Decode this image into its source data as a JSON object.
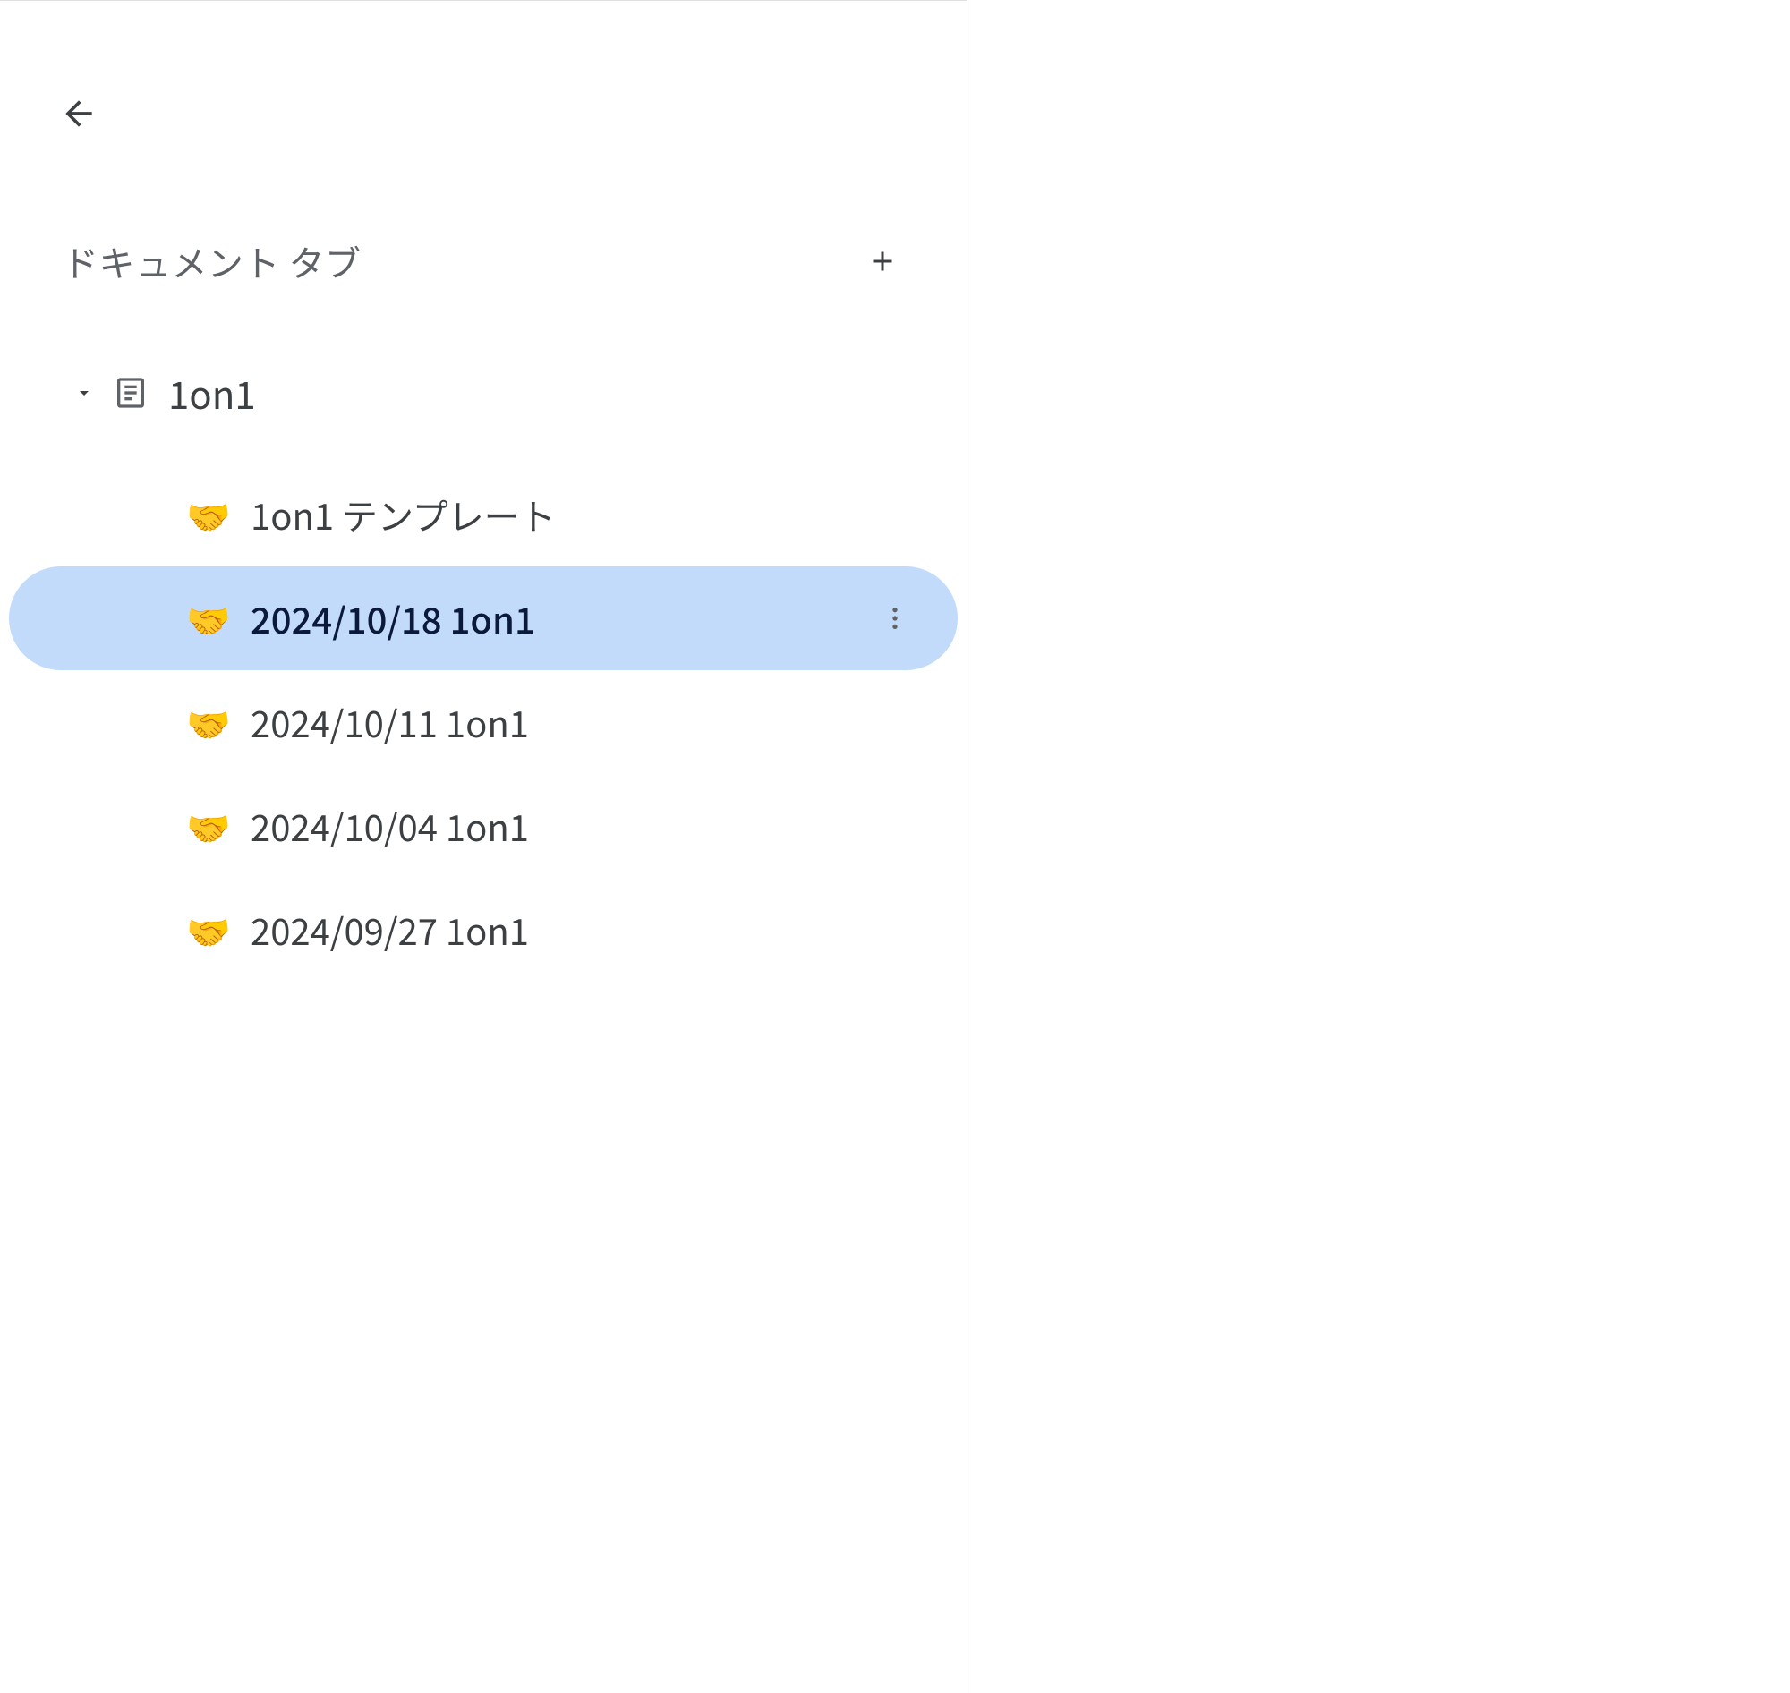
{
  "section_title": "ドキュメント タブ",
  "parent_tab": {
    "label": "1on1",
    "expanded": true
  },
  "child_tabs": [
    {
      "emoji": "🤝",
      "label": "1on1 テンプレート",
      "selected": false
    },
    {
      "emoji": "🤝",
      "label": "2024/10/18 1on1",
      "selected": true
    },
    {
      "emoji": "🤝",
      "label": "2024/10/11 1on1",
      "selected": false
    },
    {
      "emoji": "🤝",
      "label": "2024/10/04 1on1",
      "selected": false
    },
    {
      "emoji": "🤝",
      "label": "2024/09/27 1on1",
      "selected": false
    }
  ]
}
